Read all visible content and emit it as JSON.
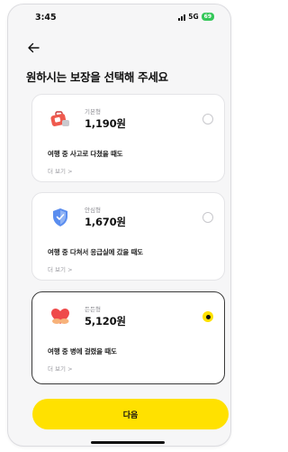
{
  "status_bar": {
    "time": "3:45",
    "network": "5G",
    "battery": "69"
  },
  "page": {
    "title": "원하시는 보장을 선택해 주세요"
  },
  "plans": [
    {
      "name": "기본형",
      "price": "1,190원",
      "description": "여행 중 사고로 다쳤을 때도",
      "more": "더 보기 >",
      "selected": false,
      "icon": "first-aid-kit-icon"
    },
    {
      "name": "안심형",
      "price": "1,670원",
      "description": "여행 중 다쳐서 응급실에 갔을 때도",
      "more": "더 보기 >",
      "selected": false,
      "icon": "shield-icon"
    },
    {
      "name": "든든형",
      "price": "5,120원",
      "description": "여행 중 병에 걸렸을 때도",
      "more": "더 보기 >",
      "selected": true,
      "icon": "heart-icon"
    }
  ],
  "footer": {
    "next_label": "다음"
  },
  "colors": {
    "accent": "#ffe100",
    "background": "#f6f6f7",
    "selected_border": "#3a3a3a",
    "battery": "#34c759"
  }
}
